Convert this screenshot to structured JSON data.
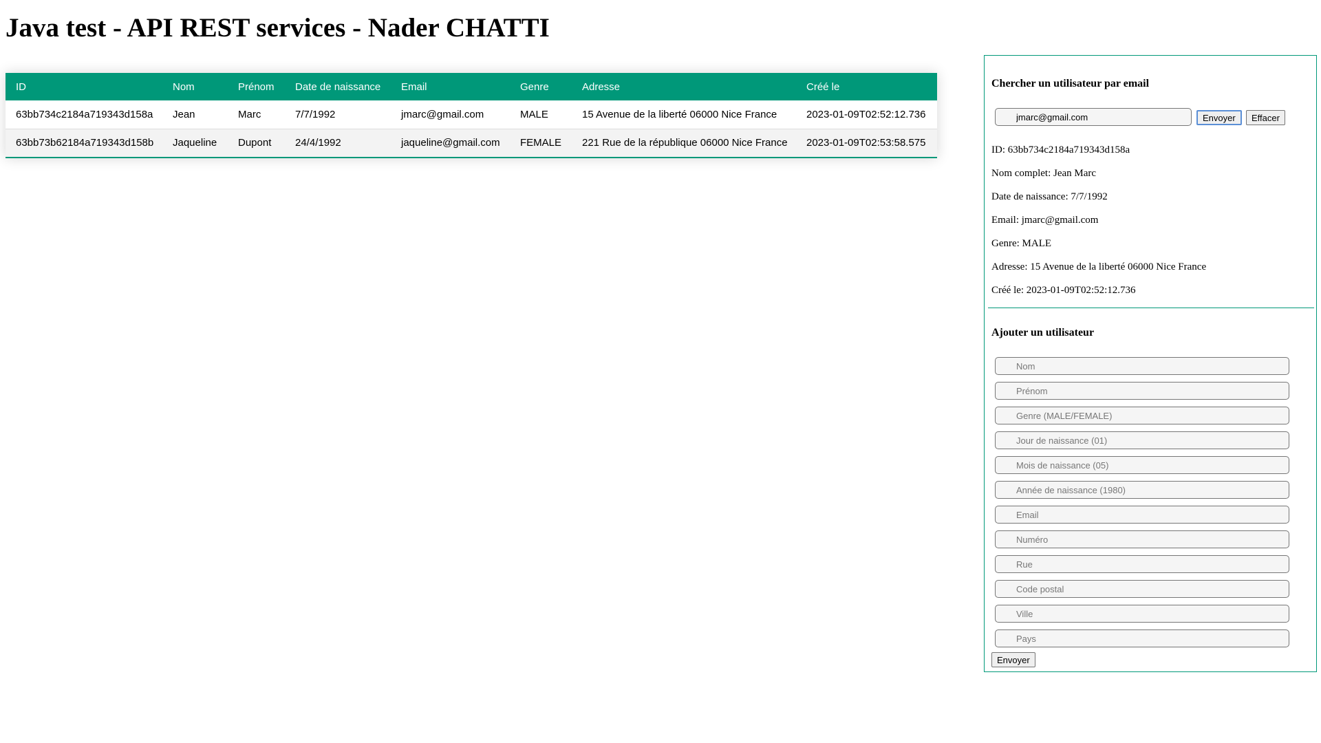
{
  "page": {
    "title": "Java test - API REST services - Nader CHATTI"
  },
  "table": {
    "headers": [
      "ID",
      "Nom",
      "Prénom",
      "Date de naissance",
      "Email",
      "Genre",
      "Adresse",
      "Créé le"
    ],
    "rows": [
      [
        "63bb734c2184a719343d158a",
        "Jean",
        "Marc",
        "7/7/1992",
        "jmarc@gmail.com",
        "MALE",
        "15 Avenue de la liberté 06000 Nice France",
        "2023-01-09T02:52:12.736"
      ],
      [
        "63bb73b62184a719343d158b",
        "Jaqueline",
        "Dupont",
        "24/4/1992",
        "jaqueline@gmail.com",
        "FEMALE",
        "221 Rue de la république 06000 Nice France",
        "2023-01-09T02:53:58.575"
      ]
    ],
    "header_color": "#009879"
  },
  "search": {
    "heading": "Chercher un utilisateur par email",
    "input_value": "jmarc@gmail.com",
    "send_label": "Envoyer",
    "clear_label": "Effacer",
    "result": [
      "ID: 63bb734c2184a719343d158a",
      "Nom complet: Jean Marc",
      "Date de naissance: 7/7/1992",
      "Email: jmarc@gmail.com",
      "Genre: MALE",
      "Adresse: 15 Avenue de la liberté 06000 Nice France",
      "Créé le: 2023-01-09T02:52:12.736"
    ]
  },
  "add_user": {
    "heading": "Ajouter un utilisateur",
    "placeholders": {
      "nom": "Nom",
      "prenom": "Prénom",
      "genre": "Genre (MALE/FEMALE)",
      "jour": "Jour de naissance (01)",
      "mois": "Mois de naissance (05)",
      "annee": "Année de naissance (1980)",
      "email": "Email",
      "numero": "Numéro",
      "rue": "Rue",
      "code_postal": "Code postal",
      "ville": "Ville",
      "pays": "Pays"
    },
    "send_label": "Envoyer"
  }
}
